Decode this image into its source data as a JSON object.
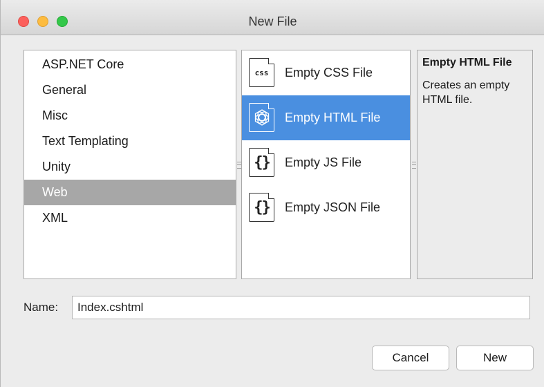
{
  "window": {
    "title": "New File",
    "controls": {
      "close_color": "#fc605c",
      "minimize_color": "#fdbc40",
      "zoom_color": "#34c84a"
    }
  },
  "categories": {
    "items": [
      {
        "label": "ASP.NET Core",
        "selected": false
      },
      {
        "label": "General",
        "selected": false
      },
      {
        "label": "Misc",
        "selected": false
      },
      {
        "label": "Text Templating",
        "selected": false
      },
      {
        "label": "Unity",
        "selected": false
      },
      {
        "label": "Web",
        "selected": true
      },
      {
        "label": "XML",
        "selected": false
      }
    ]
  },
  "templates": {
    "items": [
      {
        "label": "Empty CSS File",
        "icon": "css-file-icon",
        "icon_text": "css",
        "selected": false
      },
      {
        "label": "Empty HTML File",
        "icon": "html-file-icon",
        "icon_text": "",
        "selected": true
      },
      {
        "label": "Empty JS File",
        "icon": "js-file-icon",
        "icon_text": "{}",
        "selected": false
      },
      {
        "label": "Empty JSON File",
        "icon": "json-file-icon",
        "icon_text": "{}",
        "selected": false
      }
    ]
  },
  "details": {
    "title": "Empty HTML File",
    "description": "Creates an empty HTML file."
  },
  "name_field": {
    "label": "Name:",
    "value": "Index.cshtml"
  },
  "buttons": {
    "cancel": "Cancel",
    "new": "New"
  },
  "colors": {
    "selection_accent": "#4a8fe0",
    "category_selection": "#a7a7a7"
  }
}
